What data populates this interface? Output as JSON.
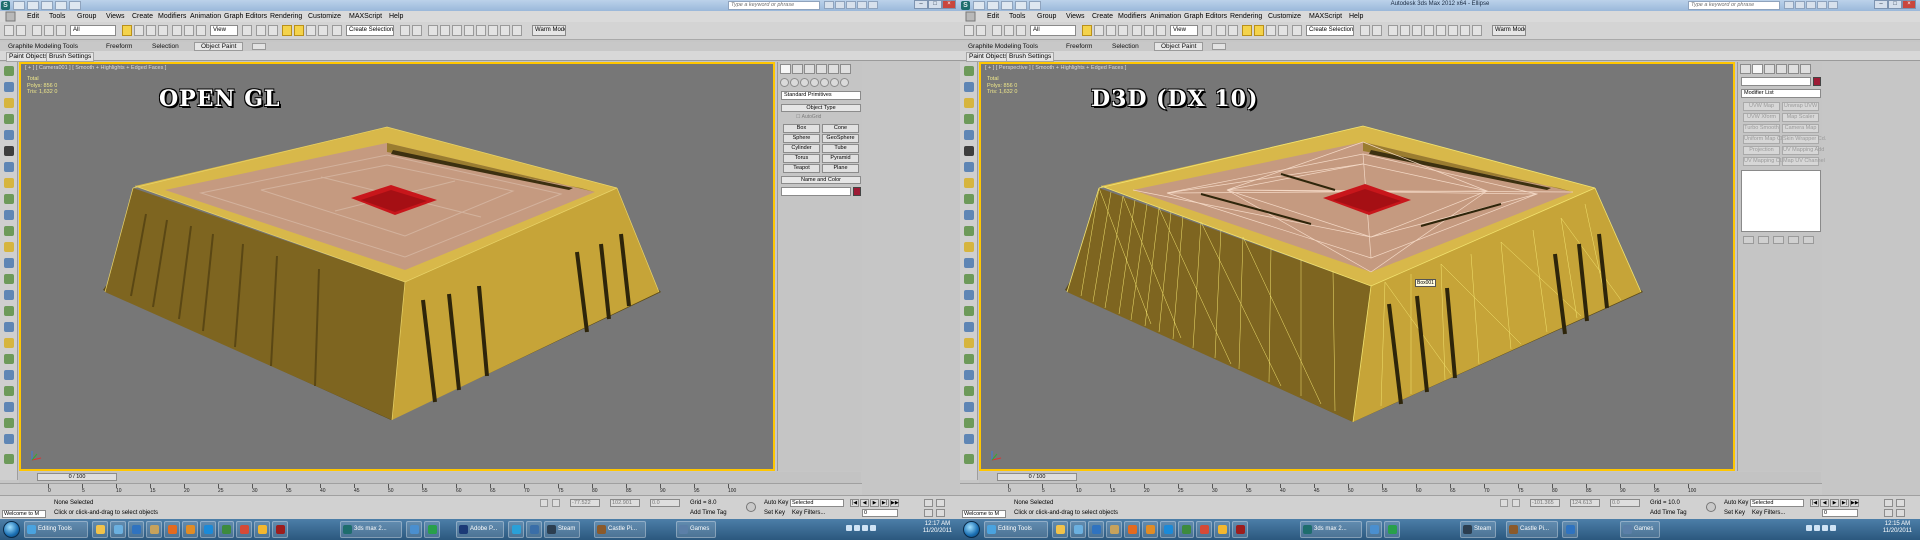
{
  "left": {
    "window_title": "",
    "search_placeholder": "Type a keyword or phrase",
    "menus": [
      "Edit",
      "Tools",
      "Group",
      "Views",
      "Create",
      "Modifiers",
      "Animation",
      "Graph Editors",
      "Rendering",
      "Customize",
      "MAXScript",
      "Help"
    ],
    "filter": "All",
    "view_ref": "View",
    "named_sel": "Create Selection Se",
    "warm_model": "Warm Model 1",
    "ribbon_tabs": [
      "Graphite Modeling Tools",
      "Freeform",
      "Selection",
      "Object Paint"
    ],
    "ribbon_sub": [
      "Paint Objects",
      "Brush Settings"
    ],
    "viewport_label": "[ + ] [ Camera001 ] [ Smooth + Highlights + Edged Faces ]",
    "stats": {
      "total": "Total",
      "polys_label": "Polys:",
      "polys_a": "856",
      "polys_b": "0",
      "tris_label": "Tris:",
      "tris_a": "1,632",
      "tris_b": "0"
    },
    "overlay": "OPEN GL",
    "cmd": {
      "category": "Standard Primitives",
      "object_type": "Object Type",
      "autogrid": "AutoGrid",
      "buttons": [
        "Box",
        "Cone",
        "Sphere",
        "GeoSphere",
        "Cylinder",
        "Tube",
        "Torus",
        "Pyramid",
        "Teapot",
        "Plane"
      ],
      "name_color": "Name and Color"
    },
    "time": "0 / 100",
    "ticks": [
      "0",
      "5",
      "10",
      "15",
      "20",
      "25",
      "30",
      "35",
      "40",
      "45",
      "50",
      "55",
      "60",
      "65",
      "70",
      "75",
      "80",
      "85",
      "90",
      "95",
      "100"
    ],
    "status": {
      "welcome": "Welcome to M",
      "none_selected": "None Selected",
      "prompt": "Click or click-and-drag to select objects",
      "x": "-77.522",
      "y": "102.901",
      "z": "0.0",
      "grid": "Grid = 8.0",
      "add_time_tag": "Add Time Tag",
      "auto_key": "Auto Key",
      "set_key": "Set Key",
      "selected": "Selected",
      "key_filters": "Key Filters...",
      "frame": "0"
    },
    "taskbar": {
      "items": [
        "Editing Tools",
        "",
        "",
        "",
        "",
        "",
        "",
        "",
        "",
        "",
        "",
        "",
        "3ds max 2...",
        "",
        "",
        "",
        "Adobe P...",
        "",
        "",
        "Steam",
        "Castle Pi...",
        "Games",
        "",
        "",
        "",
        ""
      ],
      "clock_time": "12:17 AM",
      "clock_date": "11/20/2011"
    }
  },
  "right": {
    "window_title": "Autodesk 3ds Max 2012 x64 - Ellipse",
    "search_placeholder": "Type a keyword or phrase",
    "menus": [
      "Edit",
      "Tools",
      "Group",
      "Views",
      "Create",
      "Modifiers",
      "Animation",
      "Graph Editors",
      "Rendering",
      "Customize",
      "MAXScript",
      "Help"
    ],
    "filter": "All",
    "view_ref": "View",
    "named_sel": "Create Selection Se",
    "warm_model": "Warm Model 1",
    "ribbon_tabs": [
      "Graphite Modeling Tools",
      "Freeform",
      "Selection",
      "Object Paint"
    ],
    "ribbon_sub": [
      "Paint Objects",
      "Brush Settings"
    ],
    "viewport_label": "[ + ] [ Perspective ] [ Smooth + Highlights + Edged Faces ]",
    "stats": {
      "total": "Total",
      "polys_label": "Polys:",
      "polys_a": "856",
      "polys_b": "0",
      "tris_label": "Tris:",
      "tris_a": "1,632",
      "tris_b": "0"
    },
    "overlay": "D3D (DX 10)",
    "tooltip": "Box001",
    "cmd": {
      "modifier_list": "Modifier List",
      "buttons": [
        "UVW Map",
        "Unwrap UVW",
        "UVW Xform",
        "Map Scaler",
        "Turbo Smooth",
        "Camera Map",
        "Uniform Map Ch.",
        "Skin Wrapper Cd.",
        "Projection",
        "UV Mapping Add",
        "UV Mapping Cl.",
        "Map UV Channel"
      ]
    },
    "time": "0 / 100",
    "ticks": [
      "0",
      "5",
      "10",
      "15",
      "20",
      "25",
      "30",
      "35",
      "40",
      "45",
      "50",
      "55",
      "60",
      "65",
      "70",
      "75",
      "80",
      "85",
      "90",
      "95",
      "100"
    ],
    "status": {
      "welcome": "Welcome to M",
      "none_selected": "None Selected",
      "prompt": "Click or click-and-drag to select objects",
      "x": "-101.365",
      "y": "124.613",
      "z": "0.0",
      "grid": "Grid = 10.0",
      "add_time_tag": "Add Time Tag",
      "auto_key": "Auto Key",
      "set_key": "Set Key",
      "selected": "Selected",
      "key_filters": "Key Filters...",
      "frame": "0"
    },
    "taskbar": {
      "items": [
        "Editing Tools",
        "",
        "",
        "",
        "",
        "",
        "",
        "",
        "",
        "",
        "",
        "",
        "3ds max 2...",
        "",
        "",
        "",
        "Steam",
        "Castle Pi...",
        "",
        "Games",
        "",
        "",
        "",
        ""
      ],
      "clock_time": "12:15 AM",
      "clock_date": "11/20/2011"
    }
  },
  "colors": {
    "viewport_bg": "#777777",
    "viewport_border": "#ffc600",
    "wall": "#c9a63a",
    "wall_dark": "#7d6620",
    "floor": "#c59a80",
    "red_pad": "#c8161b",
    "wire": "#f2e36f",
    "overlay_text": "#ffffff",
    "taskbar": "#2b587e"
  },
  "icons": [
    "app-logo-icon",
    "save-icon",
    "undo-icon",
    "redo-icon",
    "select-icon",
    "move-icon",
    "rotate-icon",
    "scale-icon",
    "snap-icon",
    "mirror-icon",
    "align-icon",
    "render-icon",
    "create-tab-icon",
    "modify-tab-icon",
    "hierarchy-tab-icon",
    "motion-tab-icon",
    "display-tab-icon",
    "utilities-tab-icon",
    "play-icon",
    "key-icon",
    "start-orb-icon"
  ]
}
